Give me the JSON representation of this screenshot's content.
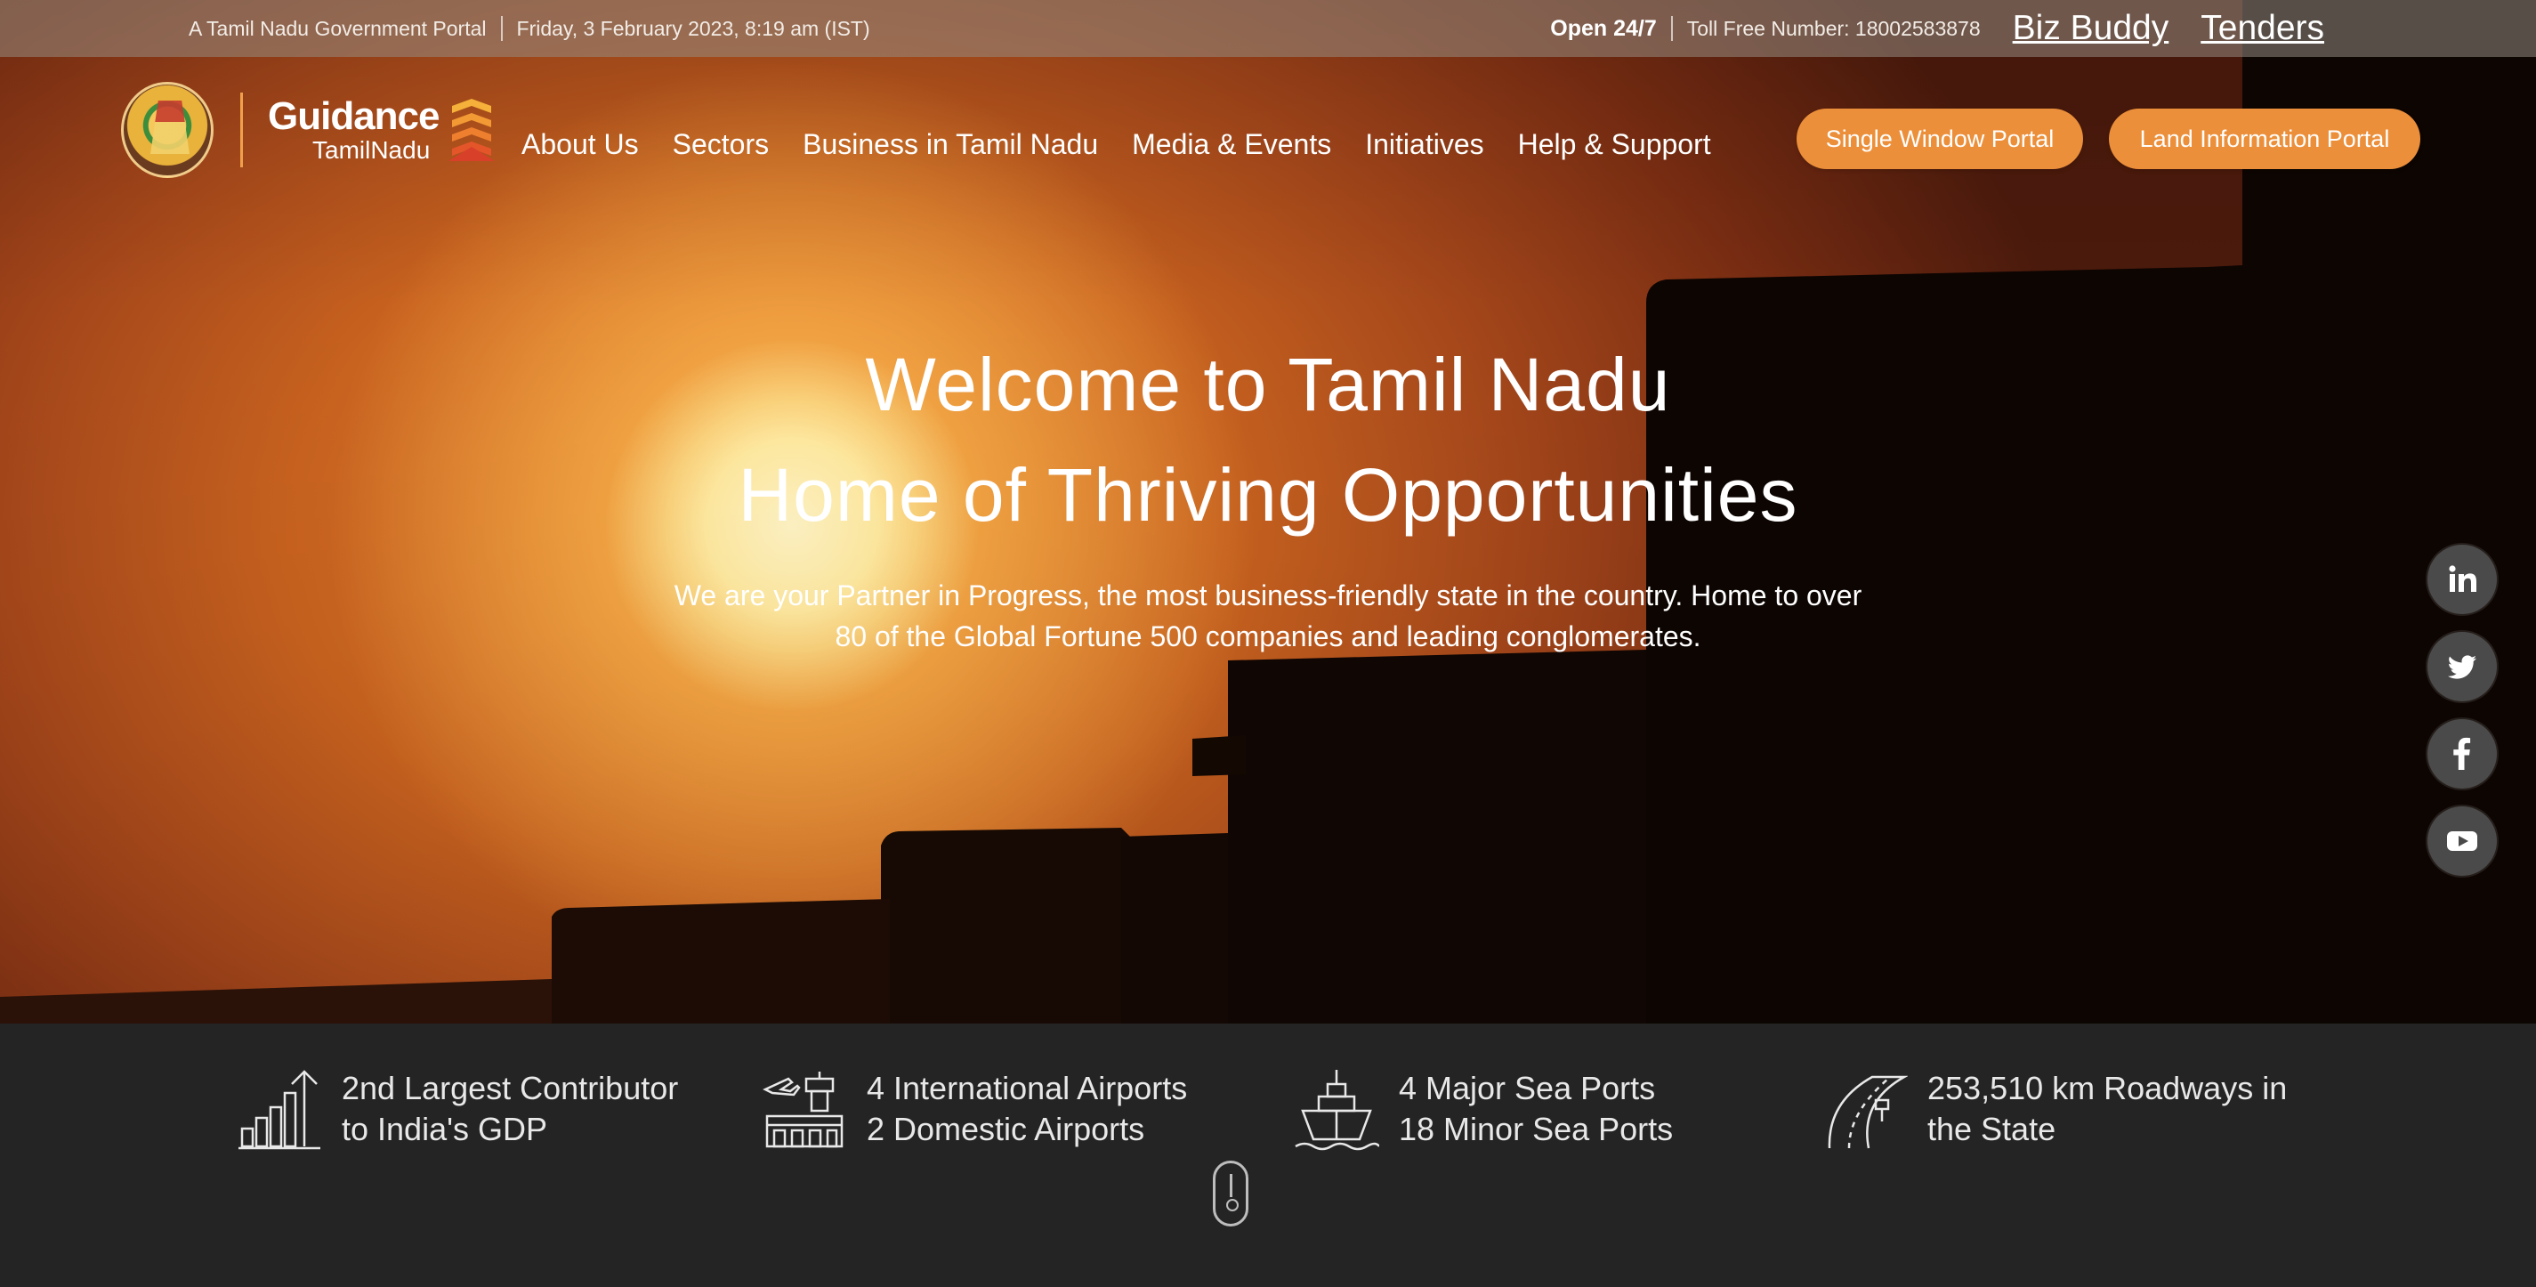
{
  "utility_bar": {
    "portal_label": "A Tamil Nadu Government Portal",
    "datetime": "Friday, 3 February 2023, 8:19 am (IST)",
    "open_label": "Open 24/7",
    "toll_free": "Toll Free Number: 18002583878",
    "links": [
      "Biz Buddy",
      "Tenders"
    ]
  },
  "brand": {
    "logo_main": "Guidance",
    "logo_sub": "TamilNadu"
  },
  "nav": {
    "items": [
      "About Us",
      "Sectors",
      "Business in Tamil Nadu",
      "Media & Events",
      "Initiatives",
      "Help & Support"
    ]
  },
  "cta": {
    "single_window": "Single Window Portal",
    "land_information": "Land Information Portal"
  },
  "hero": {
    "title_line1": "Welcome to Tamil Nadu",
    "title_line2": "Home of Thriving Opportunities",
    "description": "We are your Partner in Progress, the most business-friendly state in the country. Home to over 80 of the Global Fortune 500 companies and leading conglomerates."
  },
  "social": [
    {
      "icon": "linkedin-icon"
    },
    {
      "icon": "twitter-icon"
    },
    {
      "icon": "facebook-icon"
    },
    {
      "icon": "youtube-icon"
    }
  ],
  "stats": [
    {
      "icon": "gdp-growth-icon",
      "line1": "2nd Largest Contributor",
      "line2": "to India's GDP"
    },
    {
      "icon": "airport-icon",
      "line1": "4 International Airports",
      "line2": "2 Domestic Airports"
    },
    {
      "icon": "ship-icon",
      "line1": "4 Major Sea Ports",
      "line2": "18 Minor Sea Ports"
    },
    {
      "icon": "road-icon",
      "line1": "253,510 km Roadways in",
      "line2": "the State"
    }
  ],
  "colors": {
    "accent_orange": "#ec8f3a",
    "stats_bg": "#242424",
    "social_bg": "#4a4a4a"
  }
}
